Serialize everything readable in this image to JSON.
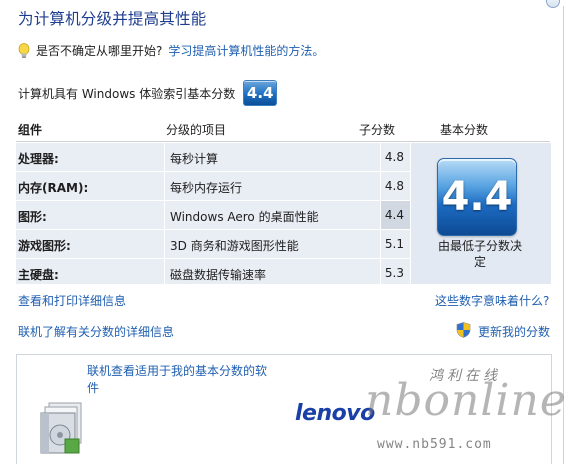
{
  "title": "为计算机分级并提高其性能",
  "tip": {
    "question": "是否不确定从哪里开始?",
    "link": "学习提高计算机性能的方法。"
  },
  "score_line": {
    "label": "计算机具有 Windows 体验索引基本分数",
    "value": "4.4"
  },
  "table": {
    "headers": {
      "component": "组件",
      "item": "分级的项目",
      "subscore": "子分数",
      "base": "基本分数"
    },
    "rows": [
      {
        "component": "处理器:",
        "item": "每秒计算",
        "subscore": "4.8"
      },
      {
        "component": "内存(RAM):",
        "item": "每秒内存运行",
        "subscore": "4.8"
      },
      {
        "component": "图形:",
        "item": "Windows Aero 的桌面性能",
        "subscore": "4.4"
      },
      {
        "component": "游戏图形:",
        "item": "3D 商务和游戏图形性能",
        "subscore": "5.1"
      },
      {
        "component": "主硬盘:",
        "item": "磁盘数据传输速率",
        "subscore": "5.3"
      }
    ],
    "base_score": "4.4",
    "base_caption": "由最低子分数决定"
  },
  "links": {
    "view_print": "查看和打印详细信息",
    "what_mean": "这些数字意味着什么?",
    "learn_online": "联机了解有关分数的详细信息",
    "update_score": "更新我的分数"
  },
  "bottom": {
    "link": "联机查看适用于我的基本分数的软件",
    "brand": "lenovo"
  },
  "watermark": {
    "script": "nbonline",
    "chinese": "鸿利在线",
    "url": "www.nb591.com"
  },
  "colors": {
    "title": "#1e3d8f",
    "link": "#1f5fb0",
    "row_bg": "#e9edf4",
    "badge": "#1e6fc0"
  }
}
